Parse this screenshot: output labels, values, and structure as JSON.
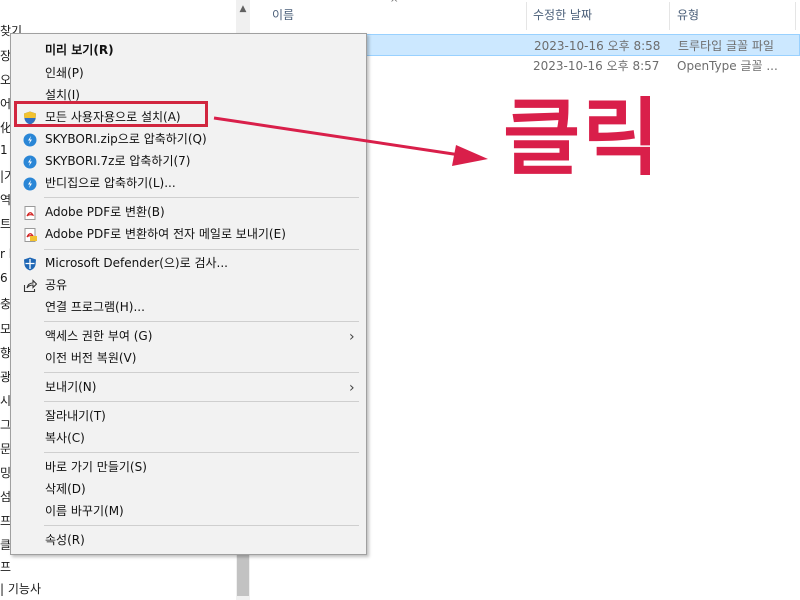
{
  "nav": {
    "items": [
      "찾기",
      "장",
      "오르",
      "어",
      "化",
      "1",
      "|기",
      "역",
      "트",
      "r l",
      "6",
      "충",
      "모임",
      "향이",
      "광기",
      "시스",
      "그",
      "문",
      "밍",
      "섬",
      "프",
      "클카",
      "프"
    ],
    "bottom_label": "| 기능사"
  },
  "file_list": {
    "columns": [
      {
        "label": "이름"
      },
      {
        "label": "수정한 날짜"
      },
      {
        "label": "유형"
      }
    ],
    "rows": [
      {
        "date": "2023-10-16 오후 8:58",
        "type": "트루타입 글꼴 파일",
        "selected": true
      },
      {
        "date": "2023-10-16 오후 8:57",
        "type": "OpenType 글꼴 ...",
        "selected": false
      }
    ]
  },
  "context_menu": {
    "items": [
      {
        "label": "미리 보기(R)",
        "bold": true
      },
      {
        "label": "인쇄(P)"
      },
      {
        "label": "설치(I)"
      },
      {
        "label": "모든 사용자용으로 설치(A)",
        "icon": "uac-shield-icon"
      },
      {
        "label": "SKYBORI.zip으로 압축하기(Q)",
        "icon": "bandizip-icon"
      },
      {
        "label": "SKYBORI.7z로 압축하기(7)",
        "icon": "bandizip-icon"
      },
      {
        "label": "반디집으로 압축하기(L)...",
        "icon": "bandizip-icon"
      },
      {
        "label": "Adobe PDF로 변환(B)",
        "icon": "adobe-pdf-icon"
      },
      {
        "label": "Adobe PDF로 변환하여 전자 메일로 보내기(E)",
        "icon": "adobe-pdf-mail-icon"
      },
      {
        "label": "Microsoft Defender(으)로 검사...",
        "icon": "defender-icon"
      },
      {
        "label": "공유",
        "icon": "share-icon"
      },
      {
        "label": "연결 프로그램(H)..."
      },
      {
        "label": "액세스 권한 부여 (G)",
        "submenu": true
      },
      {
        "label": "이전 버전 복원(V)"
      },
      {
        "label": "보내기(N)",
        "submenu": true
      },
      {
        "label": "잘라내기(T)"
      },
      {
        "label": "복사(C)"
      },
      {
        "label": "바로 가기 만들기(S)"
      },
      {
        "label": "삭제(D)"
      },
      {
        "label": "이름 바꾸기(M)"
      },
      {
        "label": "속성(R)"
      }
    ]
  },
  "annotation": {
    "text": "클릭",
    "color": "#d91f4a"
  }
}
